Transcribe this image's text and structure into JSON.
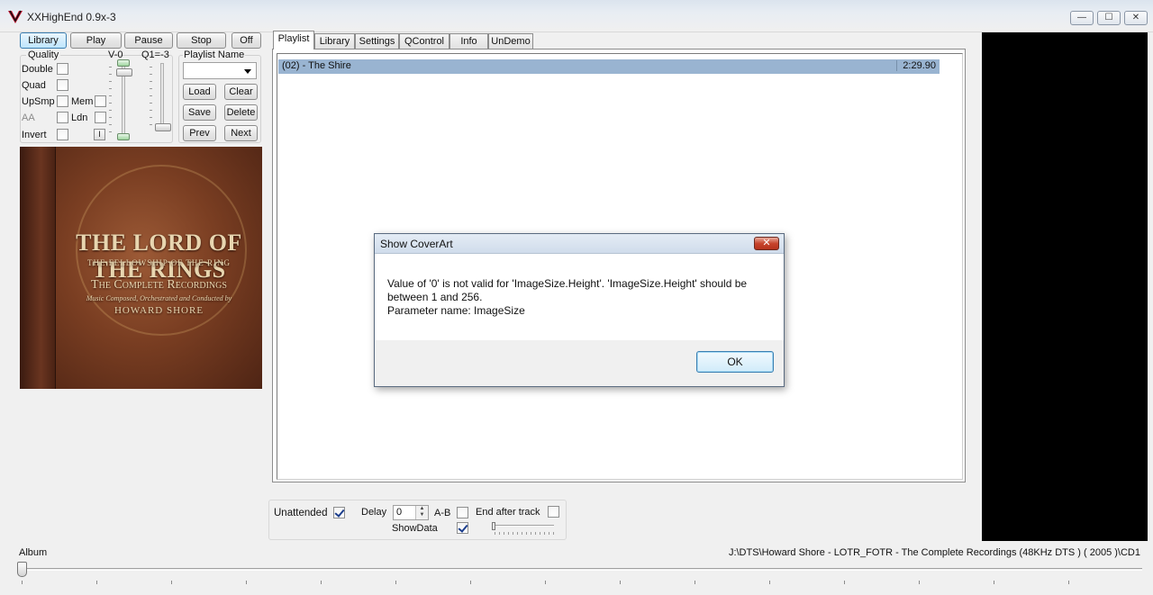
{
  "window": {
    "title": "XXHighEnd 0.9x-3",
    "controls": {
      "minimize": "—",
      "maximize": "☐",
      "close": "✕"
    }
  },
  "transport": {
    "library": "Library",
    "play": "Play",
    "pause": "Pause",
    "stop": "Stop",
    "off": "Off"
  },
  "quality": {
    "group_label": "Quality",
    "double": "Double",
    "quad": "Quad",
    "upsmp": "UpSmp",
    "mem": "Mem",
    "aa": "AA",
    "ldn": "Ldn",
    "invert": "Invert",
    "i_button": "I",
    "v_label": "V-0",
    "q_label": "Q1=-3"
  },
  "playlist_controls": {
    "label": "Playlist Name",
    "selected_value": "",
    "load": "Load",
    "clear": "Clear",
    "save": "Save",
    "delete": "Delete",
    "prev": "Prev",
    "next": "Next"
  },
  "cover_art": {
    "line1": "THE LORD OF THE RINGS",
    "line2": "THE FELLOWSHIP OF THE RING",
    "line3": "The Complete Recordings",
    "line4": "Music Composed, Orchestrated and Conducted by",
    "line5": "HOWARD SHORE"
  },
  "tabs": [
    "Playlist",
    "Library",
    "Settings",
    "QControl",
    "Info",
    "UnDemo"
  ],
  "playlist": {
    "rows": [
      {
        "title": "(02) - The Shire",
        "time": "2:29.90"
      }
    ]
  },
  "dialog": {
    "title": "Show CoverArt",
    "close": "✕",
    "message_line1": "Value of '0' is not valid for 'ImageSize.Height'. 'ImageSize.Height' should be",
    "message_line2": "between 1 and 256.",
    "message_line3": "Parameter name: ImageSize",
    "ok": "OK"
  },
  "options": {
    "unattended": "Unattended",
    "delay": "Delay",
    "delay_value": "0",
    "ab": "A-B",
    "end_after_track": "End after track",
    "show_data": "ShowData"
  },
  "status": {
    "album_label": "Album",
    "path": "J:\\DTS\\Howard Shore - LOTR_FOTR - The Complete Recordings (48KHz  DTS ) ( 2005 )\\CD1"
  },
  "colors": {
    "selection": "#99b4d1",
    "accent_blue": "#3c7fb1",
    "black_panel": "#000000"
  }
}
